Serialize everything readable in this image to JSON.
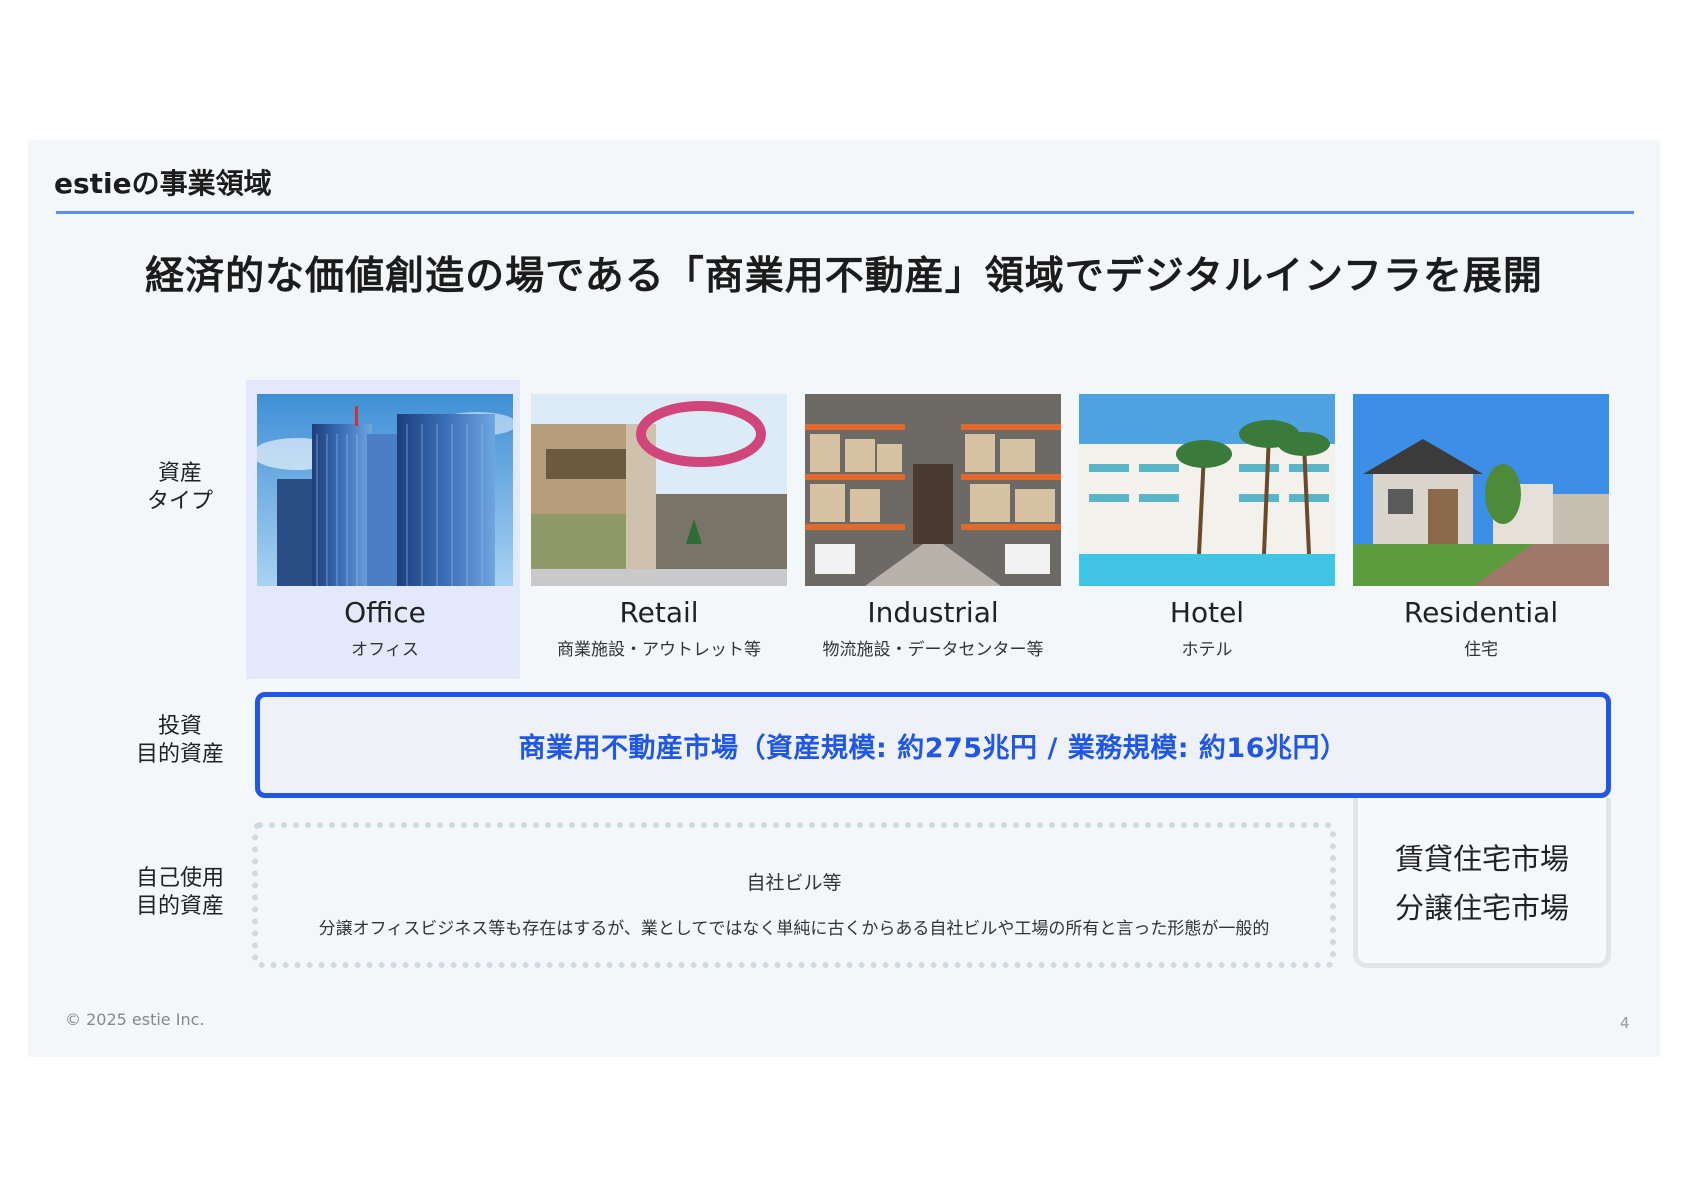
{
  "header": {
    "title": "estieの事業領域"
  },
  "headline": "経済的な価値創造の場である「商業用不動産」領域でデジタルインフラを展開",
  "row_labels": {
    "asset_type": [
      "資産",
      "タイプ"
    ],
    "investment": [
      "投資",
      "目的資産"
    ],
    "self_use": [
      "自己使用",
      "目的資産"
    ]
  },
  "asset_types": [
    {
      "name": "Office",
      "sub": "オフィス",
      "icon": "office-building-photo",
      "highlighted": true
    },
    {
      "name": "Retail",
      "sub": "商業施設・アウトレット等",
      "icon": "retail-outlet-photo"
    },
    {
      "name": "Industrial",
      "sub": "物流施設・データセンター等",
      "icon": "warehouse-photo"
    },
    {
      "name": "Hotel",
      "sub": "ホテル",
      "icon": "hotel-pool-photo"
    },
    {
      "name": "Residential",
      "sub": "住宅",
      "icon": "residential-house-photo"
    }
  ],
  "market_box": {
    "text": "商業用不動産市場（資産規模: 約275兆円 / 業務規模: 約16兆円）"
  },
  "self_use_box": {
    "title": "自社ビル等",
    "description": "分譲オフィスビジネス等も存在はするが、業としてではなく単純に古くからある自社ビルや工場の所有と言った形態が一般的"
  },
  "residential_box": {
    "line1": "賃貸住宅市場",
    "line2": "分譲住宅市場"
  },
  "footer": {
    "copyright": "© 2025 estie Inc.",
    "page": "4"
  },
  "colors": {
    "accent": "#2057e6",
    "rule": "#5b8ef0",
    "highlight": "#e3e8fb",
    "background": "#f4f7f9"
  }
}
